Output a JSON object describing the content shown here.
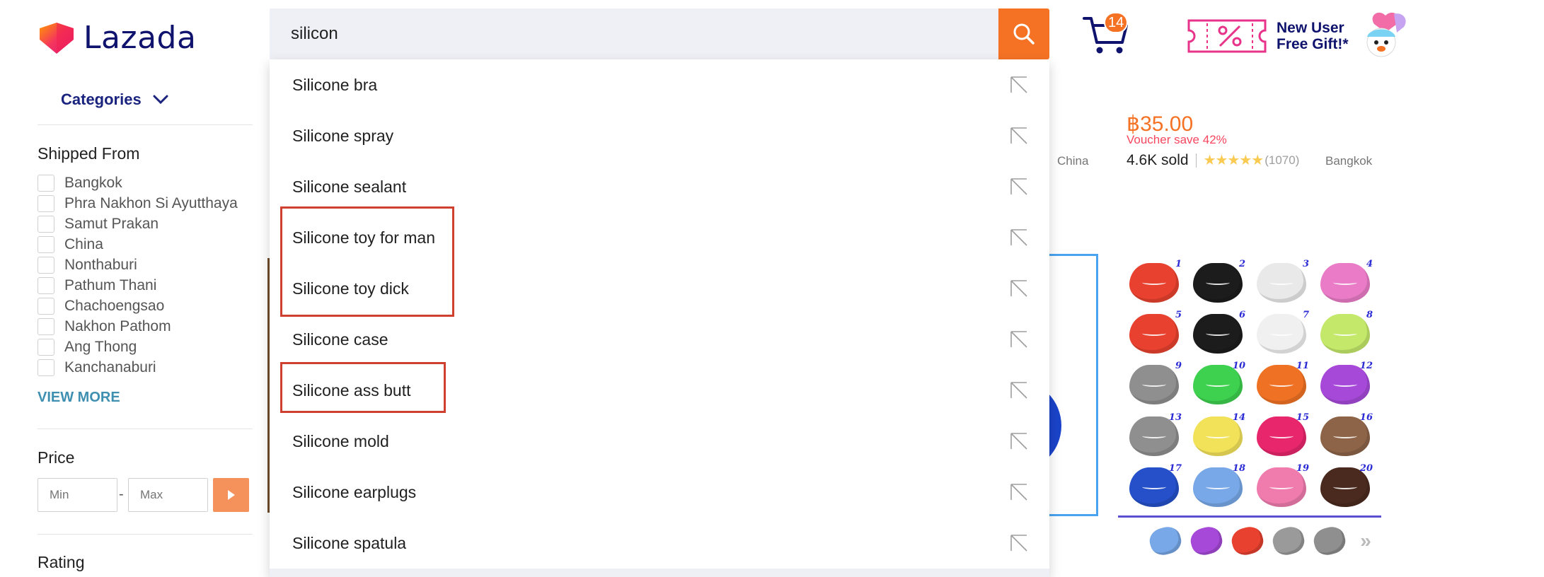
{
  "header": {
    "logo_text": "Lazada",
    "search": {
      "value": "silicon",
      "placeholder": ""
    },
    "cart_count": "14",
    "promo": {
      "line1": "New User",
      "line2": "Free Gift!*"
    }
  },
  "sidebar": {
    "categories_label": "Categories",
    "shipped_from": {
      "title": "Shipped From",
      "locations": [
        "Bangkok",
        "Phra Nakhon Si Ayutthaya",
        "Samut Prakan",
        "China",
        "Nonthaburi",
        "Pathum Thani",
        "Chachoengsao",
        "Nakhon Pathom",
        "Ang Thong",
        "Kanchanaburi"
      ],
      "view_more": "VIEW MORE"
    },
    "price": {
      "title": "Price",
      "min_placeholder": "Min",
      "max_placeholder": "Max",
      "dash": "-"
    },
    "rating": {
      "title": "Rating"
    }
  },
  "background_product": {
    "price": "฿35.00",
    "voucher": "Voucher save 42%",
    "sold": "4.6K sold",
    "stars": "★★★★★",
    "reviews": "(1070)",
    "location": "Bangkok",
    "other_location": "China"
  },
  "product_grid": {
    "numbers": [
      "1",
      "2",
      "3",
      "4",
      "5",
      "6",
      "7",
      "8",
      "9",
      "10",
      "11",
      "12",
      "13",
      "14",
      "15",
      "16",
      "17",
      "18",
      "19",
      "20"
    ],
    "colors": [
      "#e8412f",
      "#1c1c1c",
      "#e9e9e9",
      "#ea7bc7",
      "#e8412f",
      "#1c1c1c",
      "#f0f0f0",
      "#c3e86a",
      "#8f8f8f",
      "#3ed14f",
      "#ef7224",
      "#a649d9",
      "#8f8f8f",
      "#f2e25a",
      "#e8266c",
      "#8e6448",
      "#2550c9",
      "#78a8e8",
      "#f07cae",
      "#4a2a1e"
    ]
  },
  "thumb_colors": [
    "#78a8e8",
    "#a649d9",
    "#e8412f",
    "#9a9a9a",
    "#8f8f8f"
  ],
  "suggestions": [
    "Silicone bra",
    "Silicone spray",
    "Silicone sealant",
    "Silicone toy for man",
    "Silicone toy dick",
    "Silicone case",
    "Silicone ass butt",
    "Silicone mold",
    "Silicone earplugs",
    "Silicone spatula"
  ],
  "colors": {
    "accent": "#f57224",
    "brand": "#0f136d",
    "highlight": "#d0402f"
  }
}
